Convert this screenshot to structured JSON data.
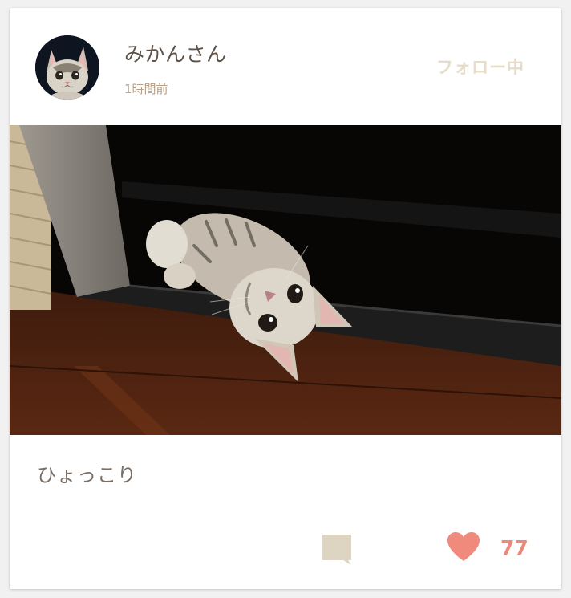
{
  "post": {
    "author": {
      "name": "みかんさん",
      "avatar_icon": "cat-avatar"
    },
    "time_ago": "1時間前",
    "follow_label": "フォロー中",
    "photo_icon": "kitten-photo",
    "caption": "ひょっこり",
    "actions": {
      "comment_icon": "comment-icon",
      "like_icon": "heart-icon",
      "like_count": "77"
    }
  },
  "colors": {
    "username": "#5e5248",
    "timestamp": "#b89f83",
    "follow": "#e6dcc8",
    "caption": "#7a6e65",
    "comment_icon": "#ddd5c2",
    "heart": "#f08a7d",
    "like_count": "#eb8a7a"
  }
}
